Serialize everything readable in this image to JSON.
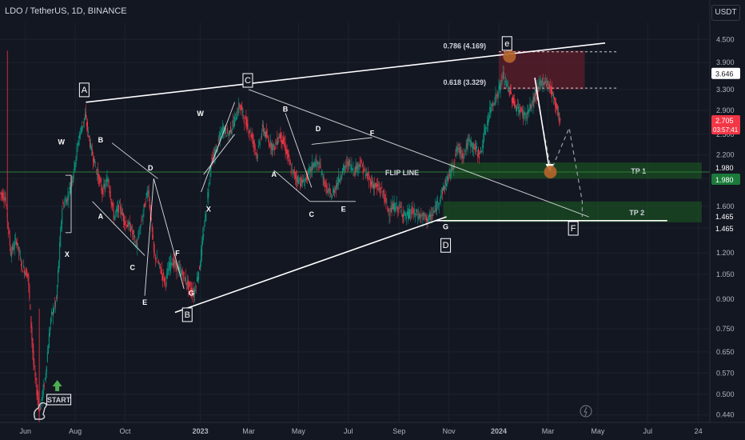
{
  "header": {
    "symbol": "LDO / TetherUS, 1D, BINANCE"
  },
  "price_axis": {
    "unit": "USDT"
  },
  "chart_data": {
    "type": "candlestick",
    "title": "LDO / TetherUS, 1D, BINANCE",
    "y_scale": "log",
    "ylim": [
      0.42,
      5.0
    ],
    "xlim": [
      "2022-05-01",
      "2024-09-15"
    ],
    "y_ticks": [
      "4.500",
      "3.900",
      "3.300",
      "2.900",
      "2.500",
      "2.200",
      "1.900",
      "1.600",
      "1.400",
      "1.200",
      "1.050",
      "0.900",
      "0.750",
      "0.650",
      "0.570",
      "0.500",
      "0.440"
    ],
    "y_tick_values": [
      4.5,
      3.9,
      3.3,
      2.9,
      2.5,
      2.2,
      1.9,
      1.6,
      1.4,
      1.2,
      1.05,
      0.9,
      0.75,
      0.65,
      0.57,
      0.5,
      0.44
    ],
    "x_ticks": [
      {
        "date": "2022-06-01",
        "label": "Jun"
      },
      {
        "date": "2022-08-01",
        "label": "Aug"
      },
      {
        "date": "2022-10-01",
        "label": "Oct"
      },
      {
        "date": "2023-01-01",
        "label": "2023"
      },
      {
        "date": "2023-03-01",
        "label": "Mar"
      },
      {
        "date": "2023-05-01",
        "label": "May"
      },
      {
        "date": "2023-07-01",
        "label": "Jul"
      },
      {
        "date": "2023-09-01",
        "label": "Sep"
      },
      {
        "date": "2023-11-01",
        "label": "Nov"
      },
      {
        "date": "2024-01-01",
        "label": "2024"
      },
      {
        "date": "2024-03-01",
        "label": "Mar"
      },
      {
        "date": "2024-05-01",
        "label": "May"
      },
      {
        "date": "2024-07-01",
        "label": "Jul"
      },
      {
        "date": "2024-09-01",
        "label": "24"
      }
    ],
    "price_path": [
      [
        "2022-05-01",
        1.75
      ],
      [
        "2022-05-08",
        1.7
      ],
      [
        "2022-05-15",
        1.2
      ],
      [
        "2022-05-22",
        1.3
      ],
      [
        "2022-05-29",
        1.1
      ],
      [
        "2022-06-05",
        1.05
      ],
      [
        "2022-06-12",
        0.6
      ],
      [
        "2022-06-19",
        0.45
      ],
      [
        "2022-06-26",
        0.55
      ],
      [
        "2022-07-03",
        0.8
      ],
      [
        "2022-07-10",
        0.9
      ],
      [
        "2022-07-17",
        1.6
      ],
      [
        "2022-07-24",
        1.7
      ],
      [
        "2022-07-31",
        2.0
      ],
      [
        "2022-08-07",
        2.5
      ],
      [
        "2022-08-14",
        2.8
      ],
      [
        "2022-08-21",
        2.3
      ],
      [
        "2022-08-28",
        2.0
      ],
      [
        "2022-09-04",
        1.75
      ],
      [
        "2022-09-11",
        1.9
      ],
      [
        "2022-09-18",
        1.5
      ],
      [
        "2022-09-25",
        1.6
      ],
      [
        "2022-10-02",
        1.45
      ],
      [
        "2022-10-09",
        1.4
      ],
      [
        "2022-10-16",
        1.25
      ],
      [
        "2022-10-23",
        1.5
      ],
      [
        "2022-10-30",
        1.8
      ],
      [
        "2022-11-06",
        1.2
      ],
      [
        "2022-11-13",
        1.1
      ],
      [
        "2022-11-20",
        1.0
      ],
      [
        "2022-11-27",
        1.15
      ],
      [
        "2022-12-04",
        1.1
      ],
      [
        "2022-12-11",
        1.05
      ],
      [
        "2022-12-18",
        0.98
      ],
      [
        "2022-12-25",
        0.93
      ],
      [
        "2023-01-01",
        1.1
      ],
      [
        "2023-01-08",
        1.5
      ],
      [
        "2023-01-15",
        2.1
      ],
      [
        "2023-01-22",
        2.3
      ],
      [
        "2023-01-29",
        2.6
      ],
      [
        "2023-02-05",
        2.5
      ],
      [
        "2023-02-12",
        2.7
      ],
      [
        "2023-02-19",
        3.0
      ],
      [
        "2023-02-26",
        2.7
      ],
      [
        "2023-03-05",
        2.5
      ],
      [
        "2023-03-12",
        2.2
      ],
      [
        "2023-03-19",
        2.6
      ],
      [
        "2023-03-26",
        2.4
      ],
      [
        "2023-04-02",
        2.3
      ],
      [
        "2023-04-09",
        2.5
      ],
      [
        "2023-04-16",
        2.3
      ],
      [
        "2023-04-23",
        2.0
      ],
      [
        "2023-04-30",
        1.9
      ],
      [
        "2023-05-07",
        1.85
      ],
      [
        "2023-05-14",
        1.95
      ],
      [
        "2023-05-21",
        2.1
      ],
      [
        "2023-05-28",
        2.05
      ],
      [
        "2023-06-04",
        1.8
      ],
      [
        "2023-06-11",
        1.7
      ],
      [
        "2023-06-18",
        1.85
      ],
      [
        "2023-06-25",
        2.0
      ],
      [
        "2023-07-02",
        2.1
      ],
      [
        "2023-07-09",
        2.0
      ],
      [
        "2023-07-16",
        2.1
      ],
      [
        "2023-07-23",
        1.95
      ],
      [
        "2023-07-30",
        1.85
      ],
      [
        "2023-08-06",
        1.8
      ],
      [
        "2023-08-13",
        1.75
      ],
      [
        "2023-08-20",
        1.55
      ],
      [
        "2023-08-27",
        1.6
      ],
      [
        "2023-09-03",
        1.58
      ],
      [
        "2023-09-10",
        1.5
      ],
      [
        "2023-09-17",
        1.55
      ],
      [
        "2023-09-24",
        1.52
      ],
      [
        "2023-10-01",
        1.5
      ],
      [
        "2023-10-08",
        1.48
      ],
      [
        "2023-10-15",
        1.55
      ],
      [
        "2023-10-22",
        1.7
      ],
      [
        "2023-10-29",
        1.85
      ],
      [
        "2023-11-05",
        2.0
      ],
      [
        "2023-11-12",
        2.3
      ],
      [
        "2023-11-19",
        2.2
      ],
      [
        "2023-11-26",
        2.4
      ],
      [
        "2023-12-03",
        2.3
      ],
      [
        "2023-12-10",
        2.2
      ],
      [
        "2023-12-17",
        2.6
      ],
      [
        "2023-12-24",
        3.0
      ],
      [
        "2023-12-31",
        3.2
      ],
      [
        "2024-01-07",
        3.6
      ],
      [
        "2024-01-14",
        3.3
      ],
      [
        "2024-01-21",
        3.0
      ],
      [
        "2024-01-28",
        2.9
      ],
      [
        "2024-02-04",
        2.8
      ],
      [
        "2024-02-11",
        3.0
      ],
      [
        "2024-02-18",
        3.3
      ],
      [
        "2024-02-25",
        3.5
      ],
      [
        "2024-03-03",
        3.4
      ],
      [
        "2024-03-10",
        3.1
      ],
      [
        "2024-03-17",
        2.705
      ]
    ],
    "current_price": {
      "label": "2.705",
      "countdown": "03:57:41"
    },
    "last_close_label": "3.646",
    "levels": [
      {
        "name": "fib-0786",
        "label": "0.786 (4.169)",
        "price": 4.169
      },
      {
        "name": "fib-0618",
        "label": "0.618 (3.329)",
        "price": 3.329
      },
      {
        "name": "flip-line",
        "label": "FLIP LINE",
        "price": 1.98
      },
      {
        "name": "f-level",
        "price": 1.465
      }
    ],
    "zones": [
      {
        "name": "resistance-zone",
        "from": "2024-01-01",
        "to": "2024-04-15",
        "low": 3.3,
        "high": 4.2
      },
      {
        "name": "tp1-zone",
        "label": "TP 1",
        "from": "2023-11-01",
        "to": "2024-09-05",
        "low": 1.9,
        "high": 2.1
      },
      {
        "name": "tp2-zone",
        "label": "TP 2",
        "from": "2023-10-25",
        "to": "2024-09-05",
        "low": 1.45,
        "high": 1.65
      }
    ],
    "axis_labels": [
      {
        "price": 1.98,
        "text": "1.980",
        "style": "dark"
      },
      {
        "price": 1.98,
        "text": "1.980",
        "style": "green"
      },
      {
        "price": 1.465,
        "text": "1.465",
        "style": "dark"
      },
      {
        "price": 1.465,
        "text": "1.465",
        "style": "dark"
      }
    ],
    "trendlines": [
      {
        "name": "upper-trendline",
        "from": [
          "2022-08-14",
          3.05
        ],
        "to": [
          "2024-05-10",
          4.4
        ]
      },
      {
        "name": "lower-trendline",
        "from": [
          "2022-12-01",
          0.83
        ],
        "to": [
          "2023-10-29",
          1.5
        ]
      },
      {
        "name": "descending-trendline",
        "from": [
          "2023-03-01",
          3.3
        ],
        "to": [
          "2024-04-20",
          1.5
        ]
      },
      {
        "name": "f-level-line",
        "from": [
          "2023-10-15",
          1.465
        ],
        "to": [
          "2024-07-25",
          1.465
        ]
      }
    ],
    "wave_labels": [
      {
        "text": "A",
        "date": "2022-08-12",
        "price": 3.3,
        "boxed": true
      },
      {
        "text": "B",
        "date": "2022-12-16",
        "price": 0.82,
        "boxed": true
      },
      {
        "text": "C",
        "date": "2023-02-28",
        "price": 3.5,
        "boxed": true
      },
      {
        "text": "D",
        "date": "2023-10-28",
        "price": 1.26,
        "boxed": true
      },
      {
        "text": "e",
        "date": "2024-01-11",
        "price": 4.4,
        "boxed": true
      },
      {
        "text": "F",
        "date": "2024-04-01",
        "price": 1.4,
        "boxed": true
      },
      {
        "text": "W",
        "date": "2022-07-15",
        "price": 2.35,
        "boxed": false
      },
      {
        "text": "X",
        "date": "2022-07-22",
        "price": 1.17,
        "boxed": false
      },
      {
        "text": "B",
        "date": "2022-09-01",
        "price": 2.38,
        "boxed": false
      },
      {
        "text": "A",
        "date": "2022-09-01",
        "price": 1.48,
        "boxed": false
      },
      {
        "text": "C",
        "date": "2022-10-10",
        "price": 1.08,
        "boxed": false
      },
      {
        "text": "D",
        "date": "2022-11-01",
        "price": 2.0,
        "boxed": false
      },
      {
        "text": "E",
        "date": "2022-10-25",
        "price": 0.87,
        "boxed": false
      },
      {
        "text": "F",
        "date": "2022-12-04",
        "price": 1.18,
        "boxed": false
      },
      {
        "text": "G",
        "date": "2022-12-21",
        "price": 0.92,
        "boxed": false
      },
      {
        "text": "W",
        "date": "2023-01-01",
        "price": 2.8,
        "boxed": false
      },
      {
        "text": "X",
        "date": "2023-01-11",
        "price": 1.55,
        "boxed": false
      },
      {
        "text": "B",
        "date": "2023-04-15",
        "price": 2.88,
        "boxed": false
      },
      {
        "text": "A",
        "date": "2023-04-01",
        "price": 1.92,
        "boxed": false
      },
      {
        "text": "D",
        "date": "2023-05-25",
        "price": 2.55,
        "boxed": false
      },
      {
        "text": "C",
        "date": "2023-05-17",
        "price": 1.5,
        "boxed": false
      },
      {
        "text": "E",
        "date": "2023-06-25",
        "price": 1.55,
        "boxed": false
      },
      {
        "text": "F",
        "date": "2023-07-30",
        "price": 2.48,
        "boxed": false
      },
      {
        "text": "G",
        "date": "2023-10-28",
        "price": 1.39,
        "boxed": false
      }
    ],
    "structure_lines": [
      {
        "from": [
          "2022-07-27",
          1.36
        ],
        "to": [
          "2022-07-27",
          1.94
        ]
      },
      {
        "from": [
          "2022-07-20",
          1.36
        ],
        "to": [
          "2022-07-27",
          1.36
        ]
      },
      {
        "from": [
          "2022-07-20",
          1.94
        ],
        "to": [
          "2022-07-27",
          1.94
        ]
      },
      {
        "from": [
          "2022-08-22",
          1.65
        ],
        "to": [
          "2022-10-25",
          1.18
        ]
      },
      {
        "from": [
          "2022-09-15",
          2.37
        ],
        "to": [
          "2022-11-10",
          1.9
        ]
      },
      {
        "from": [
          "2022-10-25",
          0.92
        ],
        "to": [
          "2022-11-05",
          1.9
        ]
      },
      {
        "from": [
          "2022-11-05",
          1.9
        ],
        "to": [
          "2022-12-12",
          0.96
        ]
      },
      {
        "from": [
          "2023-01-02",
          1.75
        ],
        "to": [
          "2023-02-12",
          3.05
        ]
      },
      {
        "from": [
          "2023-01-05",
          1.95
        ],
        "to": [
          "2023-02-12",
          2.5
        ]
      },
      {
        "from": [
          "2023-04-01",
          2.0
        ],
        "to": [
          "2023-05-15",
          1.65
        ]
      },
      {
        "from": [
          "2023-04-15",
          2.85
        ],
        "to": [
          "2023-05-17",
          1.8
        ]
      },
      {
        "from": [
          "2023-05-15",
          1.65
        ],
        "to": [
          "2023-07-10",
          1.65
        ]
      },
      {
        "from": [
          "2023-05-17",
          2.35
        ],
        "to": [
          "2023-07-30",
          2.45
        ]
      }
    ],
    "projection_path": [
      [
        "2024-02-15",
        3.3
      ],
      [
        "2024-03-05",
        2.0
      ],
      [
        "2024-03-27",
        2.6
      ],
      [
        "2024-04-12",
        1.65
      ],
      [
        "2024-04-12",
        1.5
      ]
    ],
    "projection_arrow": {
      "from": [
        "2024-02-14",
        3.55
      ],
      "to": [
        "2024-03-03",
        2.0
      ]
    },
    "markers": [
      {
        "name": "top-circle",
        "date": "2024-01-14",
        "price": 4.05,
        "color": "#b5652a"
      },
      {
        "name": "tp1-circle",
        "date": "2024-03-04",
        "price": 1.98,
        "color": "#b5652a"
      }
    ],
    "start_label": "START",
    "start_marker": {
      "date": "2022-07-10",
      "price": 0.525
    },
    "colors": {
      "bull": "#26a69a",
      "bear": "#ef5350",
      "up_fill": "#089981",
      "down_fill": "#f23645",
      "resistance": "#7a1f2e",
      "support": "#1b5e20",
      "line": "#ffffff",
      "flip": "#2e7d32"
    }
  }
}
